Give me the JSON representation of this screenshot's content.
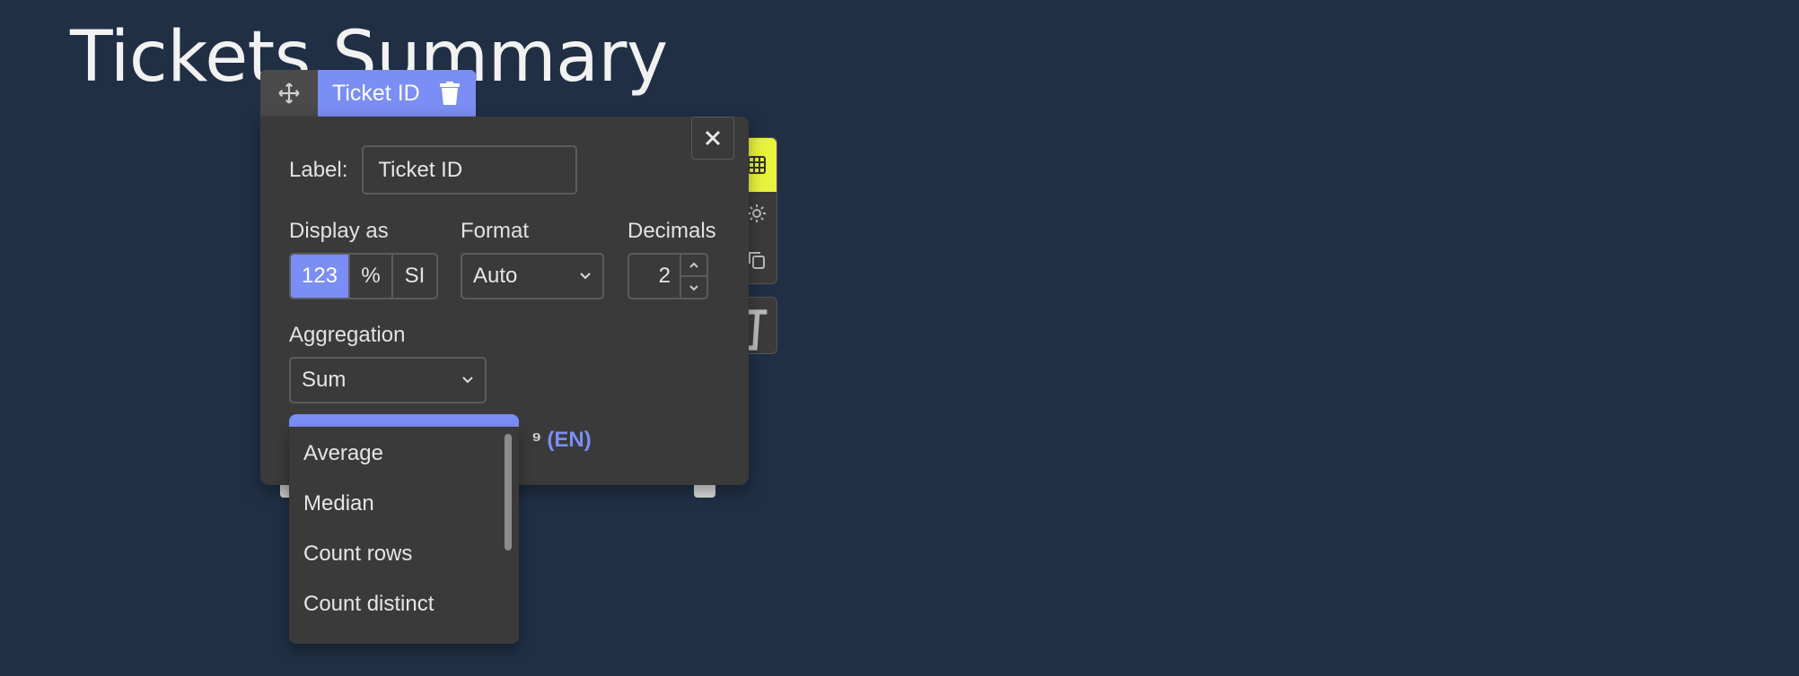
{
  "page": {
    "title": "Tickets Summary"
  },
  "field_tab": {
    "label": "Ticket ID",
    "move_icon": "move-icon",
    "delete_icon": "trash-icon"
  },
  "settings": {
    "label_caption": "Label:",
    "label_value": "Ticket ID",
    "display_as": {
      "caption": "Display as",
      "options": [
        "123",
        "%",
        "SI"
      ],
      "selected": "123"
    },
    "format": {
      "caption": "Format",
      "value": "Auto"
    },
    "decimals": {
      "caption": "Decimals",
      "value": "2"
    },
    "aggregation": {
      "caption": "Aggregation",
      "value": "Sum"
    },
    "locale": "(EN)"
  },
  "dropdown": {
    "items": [
      "Average",
      "Median",
      "Count rows",
      "Count distinct"
    ]
  },
  "colors": {
    "accent": "#7b8ef5",
    "highlight": "#e8f33d",
    "panel": "#3a3a3a",
    "background": "#202f44"
  }
}
